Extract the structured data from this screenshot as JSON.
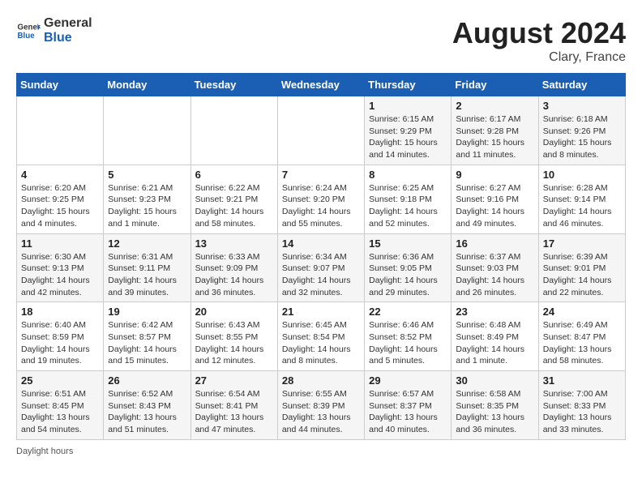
{
  "header": {
    "logo_general": "General",
    "logo_blue": "Blue",
    "month_year": "August 2024",
    "location": "Clary, France"
  },
  "weekdays": [
    "Sunday",
    "Monday",
    "Tuesday",
    "Wednesday",
    "Thursday",
    "Friday",
    "Saturday"
  ],
  "weeks": [
    [
      {
        "day": "",
        "info": ""
      },
      {
        "day": "",
        "info": ""
      },
      {
        "day": "",
        "info": ""
      },
      {
        "day": "",
        "info": ""
      },
      {
        "day": "1",
        "info": "Sunrise: 6:15 AM\nSunset: 9:29 PM\nDaylight: 15 hours and 14 minutes."
      },
      {
        "day": "2",
        "info": "Sunrise: 6:17 AM\nSunset: 9:28 PM\nDaylight: 15 hours and 11 minutes."
      },
      {
        "day": "3",
        "info": "Sunrise: 6:18 AM\nSunset: 9:26 PM\nDaylight: 15 hours and 8 minutes."
      }
    ],
    [
      {
        "day": "4",
        "info": "Sunrise: 6:20 AM\nSunset: 9:25 PM\nDaylight: 15 hours and 4 minutes."
      },
      {
        "day": "5",
        "info": "Sunrise: 6:21 AM\nSunset: 9:23 PM\nDaylight: 15 hours and 1 minute."
      },
      {
        "day": "6",
        "info": "Sunrise: 6:22 AM\nSunset: 9:21 PM\nDaylight: 14 hours and 58 minutes."
      },
      {
        "day": "7",
        "info": "Sunrise: 6:24 AM\nSunset: 9:20 PM\nDaylight: 14 hours and 55 minutes."
      },
      {
        "day": "8",
        "info": "Sunrise: 6:25 AM\nSunset: 9:18 PM\nDaylight: 14 hours and 52 minutes."
      },
      {
        "day": "9",
        "info": "Sunrise: 6:27 AM\nSunset: 9:16 PM\nDaylight: 14 hours and 49 minutes."
      },
      {
        "day": "10",
        "info": "Sunrise: 6:28 AM\nSunset: 9:14 PM\nDaylight: 14 hours and 46 minutes."
      }
    ],
    [
      {
        "day": "11",
        "info": "Sunrise: 6:30 AM\nSunset: 9:13 PM\nDaylight: 14 hours and 42 minutes."
      },
      {
        "day": "12",
        "info": "Sunrise: 6:31 AM\nSunset: 9:11 PM\nDaylight: 14 hours and 39 minutes."
      },
      {
        "day": "13",
        "info": "Sunrise: 6:33 AM\nSunset: 9:09 PM\nDaylight: 14 hours and 36 minutes."
      },
      {
        "day": "14",
        "info": "Sunrise: 6:34 AM\nSunset: 9:07 PM\nDaylight: 14 hours and 32 minutes."
      },
      {
        "day": "15",
        "info": "Sunrise: 6:36 AM\nSunset: 9:05 PM\nDaylight: 14 hours and 29 minutes."
      },
      {
        "day": "16",
        "info": "Sunrise: 6:37 AM\nSunset: 9:03 PM\nDaylight: 14 hours and 26 minutes."
      },
      {
        "day": "17",
        "info": "Sunrise: 6:39 AM\nSunset: 9:01 PM\nDaylight: 14 hours and 22 minutes."
      }
    ],
    [
      {
        "day": "18",
        "info": "Sunrise: 6:40 AM\nSunset: 8:59 PM\nDaylight: 14 hours and 19 minutes."
      },
      {
        "day": "19",
        "info": "Sunrise: 6:42 AM\nSunset: 8:57 PM\nDaylight: 14 hours and 15 minutes."
      },
      {
        "day": "20",
        "info": "Sunrise: 6:43 AM\nSunset: 8:55 PM\nDaylight: 14 hours and 12 minutes."
      },
      {
        "day": "21",
        "info": "Sunrise: 6:45 AM\nSunset: 8:54 PM\nDaylight: 14 hours and 8 minutes."
      },
      {
        "day": "22",
        "info": "Sunrise: 6:46 AM\nSunset: 8:52 PM\nDaylight: 14 hours and 5 minutes."
      },
      {
        "day": "23",
        "info": "Sunrise: 6:48 AM\nSunset: 8:49 PM\nDaylight: 14 hours and 1 minute."
      },
      {
        "day": "24",
        "info": "Sunrise: 6:49 AM\nSunset: 8:47 PM\nDaylight: 13 hours and 58 minutes."
      }
    ],
    [
      {
        "day": "25",
        "info": "Sunrise: 6:51 AM\nSunset: 8:45 PM\nDaylight: 13 hours and 54 minutes."
      },
      {
        "day": "26",
        "info": "Sunrise: 6:52 AM\nSunset: 8:43 PM\nDaylight: 13 hours and 51 minutes."
      },
      {
        "day": "27",
        "info": "Sunrise: 6:54 AM\nSunset: 8:41 PM\nDaylight: 13 hours and 47 minutes."
      },
      {
        "day": "28",
        "info": "Sunrise: 6:55 AM\nSunset: 8:39 PM\nDaylight: 13 hours and 44 minutes."
      },
      {
        "day": "29",
        "info": "Sunrise: 6:57 AM\nSunset: 8:37 PM\nDaylight: 13 hours and 40 minutes."
      },
      {
        "day": "30",
        "info": "Sunrise: 6:58 AM\nSunset: 8:35 PM\nDaylight: 13 hours and 36 minutes."
      },
      {
        "day": "31",
        "info": "Sunrise: 7:00 AM\nSunset: 8:33 PM\nDaylight: 13 hours and 33 minutes."
      }
    ]
  ],
  "footer": {
    "daylight_label": "Daylight hours"
  }
}
